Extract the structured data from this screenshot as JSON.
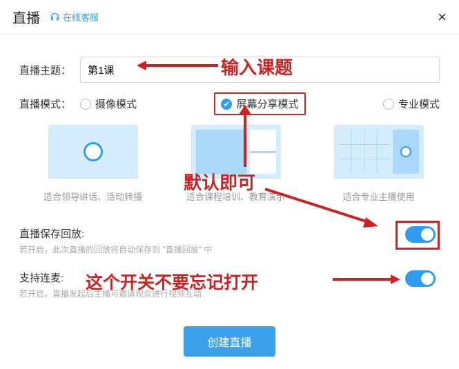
{
  "header": {
    "title": "直播",
    "customer_service": "在线客服"
  },
  "topic": {
    "label": "直播主题：",
    "value": "第1课"
  },
  "mode": {
    "label": "直播模式：",
    "options": {
      "camera": {
        "label": "摄像模式",
        "caption": "适合领导讲话、活动转播"
      },
      "screen": {
        "label": "屏幕分享模式",
        "caption": "适合课程培训、教育演示"
      },
      "pro": {
        "label": "专业模式",
        "caption": "适合专业主播使用"
      }
    }
  },
  "replay": {
    "title": "直播保存回放:",
    "hint": "若开启，此次直播的回放将自动保存到 \"直播回放\" 中"
  },
  "mic": {
    "title": "支持连麦:",
    "hint": "若开启，直播发起后主播可邀请观众进行视频互动"
  },
  "footer": {
    "create": "创建直播"
  },
  "annotations": {
    "enter_topic": "输入课题",
    "default_ok": "默认即可",
    "mic_reminder": "这个开关不要忘记打开"
  }
}
